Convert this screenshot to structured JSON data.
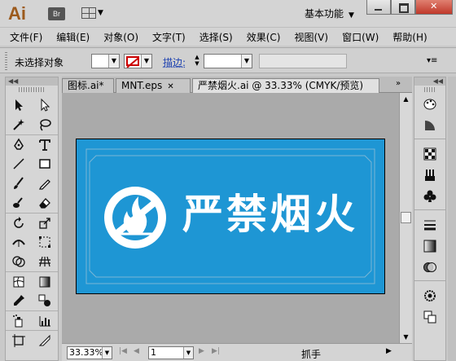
{
  "app": {
    "logo": "Ai",
    "bridge_badge": "Br",
    "workspace": "基本功能"
  },
  "menu": [
    "文件(F)",
    "编辑(E)",
    "对象(O)",
    "文字(T)",
    "选择(S)",
    "效果(C)",
    "视图(V)",
    "窗口(W)",
    "帮助(H)"
  ],
  "control_bar": {
    "selection_status": "未选择对象",
    "stroke_label": "描边:"
  },
  "tabs": [
    {
      "label": "图标.ai*",
      "active": false
    },
    {
      "label": "MNT.eps",
      "active": false
    },
    {
      "label": "严禁烟火.ai @ 33.33% (CMYK/预览)",
      "active": true
    }
  ],
  "artwork": {
    "text": "严禁烟火",
    "background_color": "#1e96d4",
    "foreground_color": "#ffffff",
    "icon": "no-fire-icon"
  },
  "status_bar": {
    "zoom": "33.33%",
    "page": "1",
    "tool_status": "抓手"
  }
}
